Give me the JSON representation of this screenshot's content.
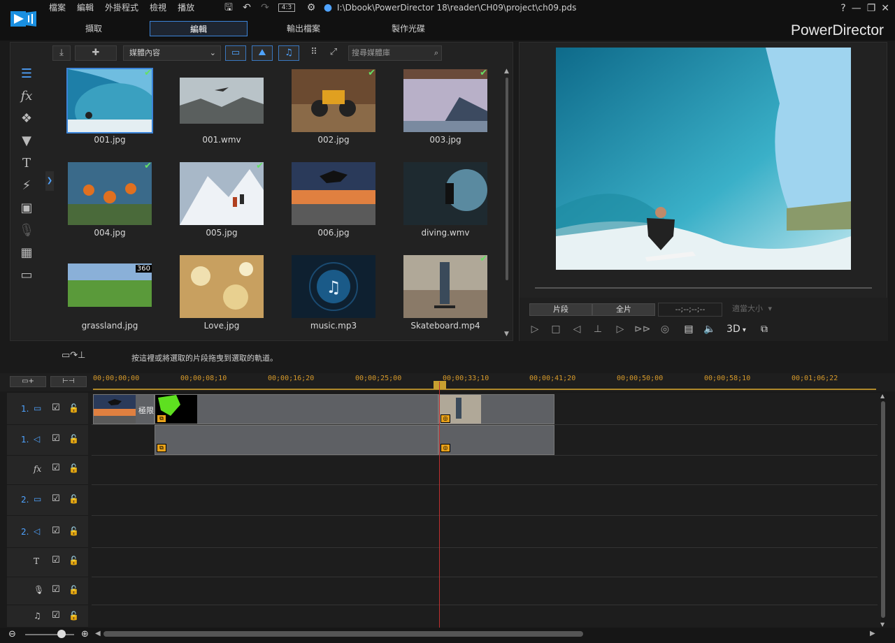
{
  "app": {
    "name": "PowerDirector",
    "file_path": "I:\\Dbook\\PowerDirector 18\\reader\\CH09\\project\\ch09.pds",
    "aspect_ratio": "4:3"
  },
  "menu": [
    "檔案",
    "編輯",
    "外掛程式",
    "檢視",
    "播放"
  ],
  "tabs": [
    {
      "label": "擷取",
      "active": false
    },
    {
      "label": "編輯",
      "active": true
    },
    {
      "label": "輸出檔案",
      "active": false
    },
    {
      "label": "製作光碟",
      "active": false
    }
  ],
  "window_controls": [
    "?",
    "—",
    "❐",
    "✕"
  ],
  "media": {
    "filter_label": "媒體內容",
    "search_placeholder": "搜尋媒體庫",
    "items": [
      {
        "name": "001.jpg",
        "selected": true,
        "used": true
      },
      {
        "name": "001.wmv",
        "selected": false,
        "used": false
      },
      {
        "name": "002.jpg",
        "selected": false,
        "used": true
      },
      {
        "name": "003.jpg",
        "selected": false,
        "used": true
      },
      {
        "name": "004.jpg",
        "selected": false,
        "used": true
      },
      {
        "name": "005.jpg",
        "selected": false,
        "used": true
      },
      {
        "name": "006.jpg",
        "selected": false,
        "used": false
      },
      {
        "name": "diving.wmv",
        "selected": false,
        "used": false
      },
      {
        "name": "grassland.jpg",
        "selected": false,
        "used": false,
        "badge": "360"
      },
      {
        "name": "Love.jpg",
        "selected": false,
        "used": false
      },
      {
        "name": "music.mp3",
        "selected": false,
        "used": false
      },
      {
        "name": "Skateboard.mp4",
        "selected": false,
        "used": true
      }
    ]
  },
  "preview": {
    "clip_label": "片段",
    "full_label": "全片",
    "timecode": "--;--;--;--",
    "fit_label": "適當大小",
    "mode_3d": "3D"
  },
  "timeline": {
    "hint": "按這裡或將選取的片段拖曳到選取的軌道。",
    "ruler_ticks": [
      "00;00;00;00",
      "00;00;08;10",
      "00;00;16;20",
      "00;00;25;00",
      "00;00;33;10",
      "00;00;41;20",
      "00;00;50;00",
      "00;00;58;10",
      "00;01;06;22"
    ],
    "tracks": [
      {
        "number": "1.",
        "kind": "video"
      },
      {
        "number": "1.",
        "kind": "audio"
      },
      {
        "number": "",
        "kind": "fx"
      },
      {
        "number": "2.",
        "kind": "video"
      },
      {
        "number": "2.",
        "kind": "audio"
      },
      {
        "number": "",
        "kind": "title"
      },
      {
        "number": "",
        "kind": "voice"
      },
      {
        "number": "",
        "kind": "music"
      }
    ],
    "transition_label": "極限"
  },
  "colors": {
    "accent": "#3c84d8",
    "ruler": "#d79a2a",
    "playhead": "#c03030",
    "used_check": "#66e066"
  }
}
